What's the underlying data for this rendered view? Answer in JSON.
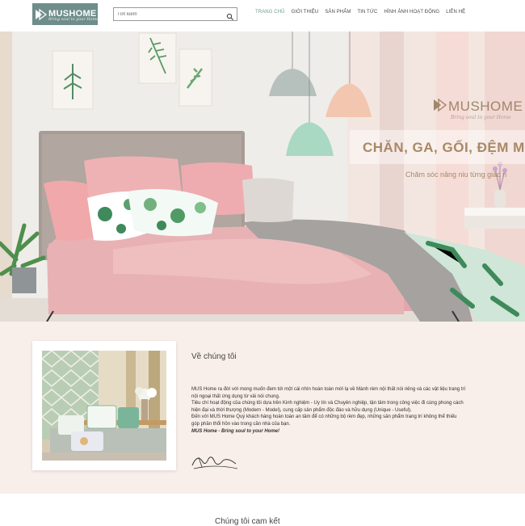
{
  "brand": {
    "name": "MUSHOME",
    "tagline": "Bring soul to your Home",
    "logo_bg": "#6f8d8a"
  },
  "search": {
    "placeholder": "Tìm kiếm"
  },
  "nav": {
    "items": [
      {
        "label": "TRANG CHỦ",
        "active": true
      },
      {
        "label": "GIỚI THIỆU",
        "active": false
      },
      {
        "label": "SẢN PHẨM",
        "active": false
      },
      {
        "label": "TIN TỨC",
        "active": false
      },
      {
        "label": "HÌNH ẢNH HOẠT ĐỘNG",
        "active": false
      },
      {
        "label": "LIÊN HỆ",
        "active": false
      }
    ],
    "active_color": "#6c9b95"
  },
  "hero": {
    "logo_text": "MUSHOME",
    "logo_tagline": "Bring soul to your Home",
    "title": "CHĂN, GA, GỐI, ĐỆM MU",
    "subtitle": "Chăm sóc nâng niu từng giấc n",
    "accent_color": "#a98866"
  },
  "about": {
    "heading": "Về chúng tôi",
    "paragraphs": [
      "MUS Home ra đời với mong muốn đem tới một cái nhìn hoàn toàn mới lạ về Mành rèm nội thất nói riêng và các vật liệu trang trí nội ngoại thất ứng dụng từ vải nói chung.",
      "Tiêu chí hoạt động của chúng tôi dựa trên Kinh nghiệm - Uy tín và Chuyên nghiệp, tận tâm trong công việc đi cùng phong cách hiện đại và thời thượng (Modern - Model), cung cấp sản phẩm độc đáo và hữu dụng (Unique - Useful).",
      "Đến với MUS Home Quý khách hàng hoàn toàn an tâm để có những bộ rèm đẹp, những sản phẩm trang trí không thể thiếu góp phần thổi hồn vào trong căn nhà của bạn."
    ],
    "slogan": "MUS Home - Bring soul to your Home!",
    "background": "#f8efea"
  },
  "commitment": {
    "heading": "Chúng tôi cam kết"
  }
}
